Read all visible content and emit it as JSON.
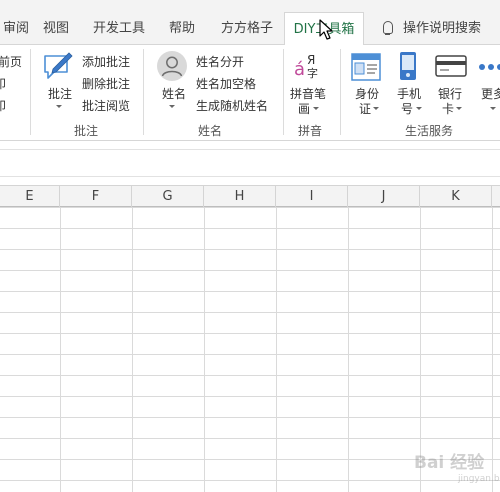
{
  "tabs": [
    {
      "label": "审阅",
      "partial": "审阅"
    },
    {
      "label": "视图"
    },
    {
      "label": "开发工具"
    },
    {
      "label": "帮助"
    },
    {
      "label": "方方格子"
    },
    {
      "label": "DIY工具箱"
    },
    {
      "label": "操作说明搜索"
    }
  ],
  "ribbon": {
    "left_partial": {
      "l1": "前页",
      "l2": "印",
      "l3": "印"
    },
    "comments": {
      "big_label": "批注",
      "items": [
        "添加批注",
        "删除批注",
        "批注阅览"
      ],
      "group": "批注"
    },
    "names": {
      "big_label": "姓名",
      "items": [
        "姓名分开",
        "姓名加空格",
        "生成随机姓名"
      ],
      "group": "姓名"
    },
    "pinyin": {
      "big_line1": "拼音笔",
      "big_line2": "画",
      "icon_chars": "á Я 字",
      "group": "拼音"
    },
    "life": {
      "id_card": {
        "l1": "身份",
        "l2": "证"
      },
      "phone": {
        "l1": "手机",
        "l2": "号"
      },
      "bank": {
        "l1": "银行",
        "l2": "卡"
      },
      "more": {
        "l1": "更多"
      },
      "group": "生活服务"
    }
  },
  "columns": [
    "E",
    "F",
    "G",
    "H",
    "I",
    "J",
    "K"
  ],
  "watermark": {
    "main": "Bai 经验",
    "sub": "jingyan.baidu.com"
  }
}
